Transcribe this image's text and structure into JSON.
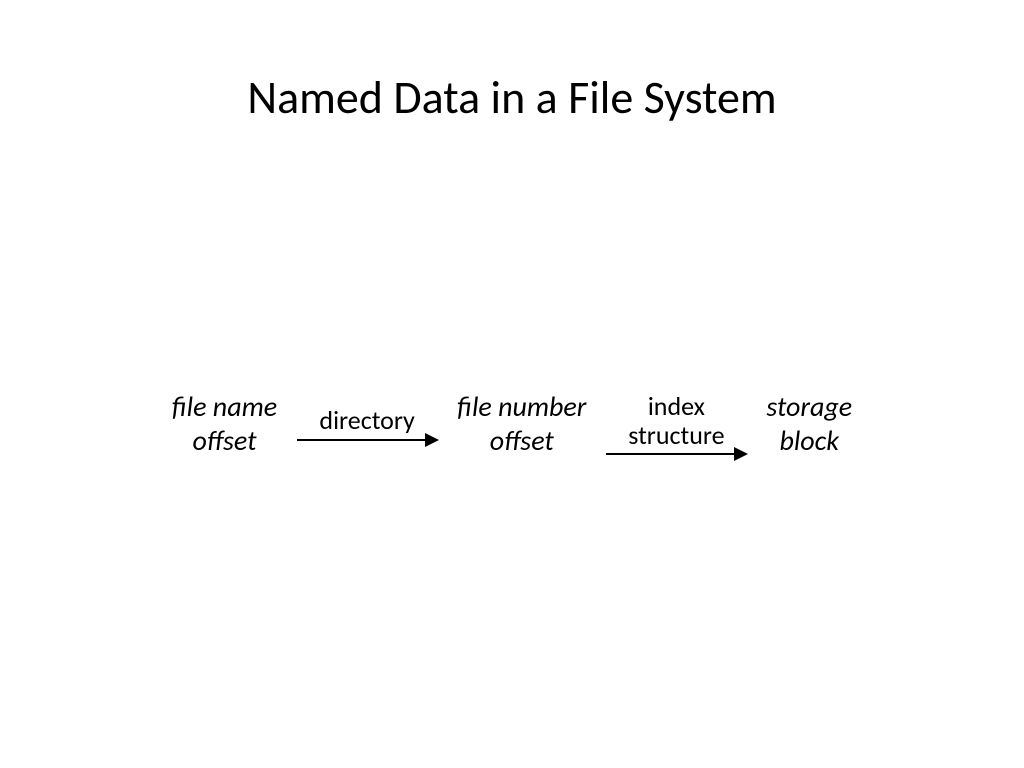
{
  "title": "Named Data in a File System",
  "diagram": {
    "node1": {
      "line1": "file name",
      "line2": "offset"
    },
    "arrow1": {
      "label": "directory"
    },
    "node2": {
      "line1": "file number",
      "line2": "offset"
    },
    "arrow2": {
      "label_line1": "index",
      "label_line2": "structure"
    },
    "node3": {
      "line1": "storage",
      "line2": "block"
    }
  }
}
